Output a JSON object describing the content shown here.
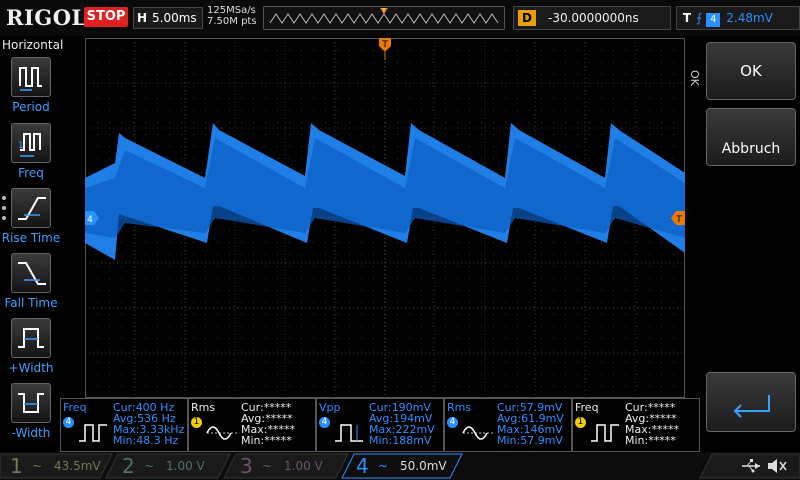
{
  "top": {
    "brand": "RIGOL",
    "run_state": "STOP",
    "timebase_key": "H",
    "timebase_value": "5.00ms",
    "sample_rate": "125MSa/s",
    "memory_depth": "7.50M pts",
    "delay_key": "D",
    "delay_value": "-30.0000000ns",
    "trigger_key": "T",
    "trigger_edge": "⨍",
    "trigger_channel": "4",
    "trigger_level": "2.48mV"
  },
  "left_menu": {
    "title": "Horizontal",
    "items": [
      {
        "label": "Period"
      },
      {
        "label": "Freq"
      },
      {
        "label": "Rise Time"
      },
      {
        "label": "Fall Time"
      },
      {
        "label": "+Width"
      },
      {
        "label": "-Width"
      }
    ]
  },
  "markers": {
    "trigger_top": "T",
    "trigger_right": "T",
    "channel_left": "4"
  },
  "right_menu": {
    "ok_label": "OK",
    "abbruch_label": "Abbruch",
    "side_label": "OK"
  },
  "measurements": [
    {
      "name": "Freq",
      "channel": "4",
      "cur": "Cur:400 Hz",
      "avg": "Avg:536 Hz",
      "max": "Max:3.33kHz",
      "min": "Min:48.3 Hz",
      "color": "#2a90ff"
    },
    {
      "name": "Rms",
      "channel": "1",
      "cur": "Cur:*****",
      "avg": "Avg:*****",
      "max": "Max:*****",
      "min": "Min:*****",
      "color": "#f0d000"
    },
    {
      "name": "Vpp",
      "channel": "4",
      "cur": "Cur:190mV",
      "avg": "Avg:194mV",
      "max": "Max:222mV",
      "min": "Min:188mV",
      "color": "#2a90ff"
    },
    {
      "name": "Rms",
      "channel": "4",
      "cur": "Cur:57.9mV",
      "avg": "Avg:61.9mV",
      "max": "Max:146mV",
      "min": "Min:57.9mV",
      "color": "#2a90ff"
    },
    {
      "name": "Freq",
      "channel": "1",
      "cur": "Cur:*****",
      "avg": "Avg:*****",
      "max": "Max:*****",
      "min": "Min:*****",
      "color": "#f0d000"
    }
  ],
  "channels": [
    {
      "num": "1",
      "coupling": "~",
      "scale": "43.5mV",
      "color": "#777755"
    },
    {
      "num": "2",
      "coupling": "~",
      "scale": "1.00 V",
      "color": "#4f6f6f"
    },
    {
      "num": "3",
      "coupling": "~",
      "scale": "1.00 V",
      "color": "#6f4f6f"
    },
    {
      "num": "4",
      "coupling": "~",
      "scale": "50.0mV",
      "color": "#2a90ff"
    }
  ],
  "status_icons": [
    "usb-icon",
    "speaker-mute-icon"
  ],
  "colors": {
    "ch4": "#1f7fe6",
    "trigger": "#e87a00",
    "run_stop": "#e02020"
  }
}
